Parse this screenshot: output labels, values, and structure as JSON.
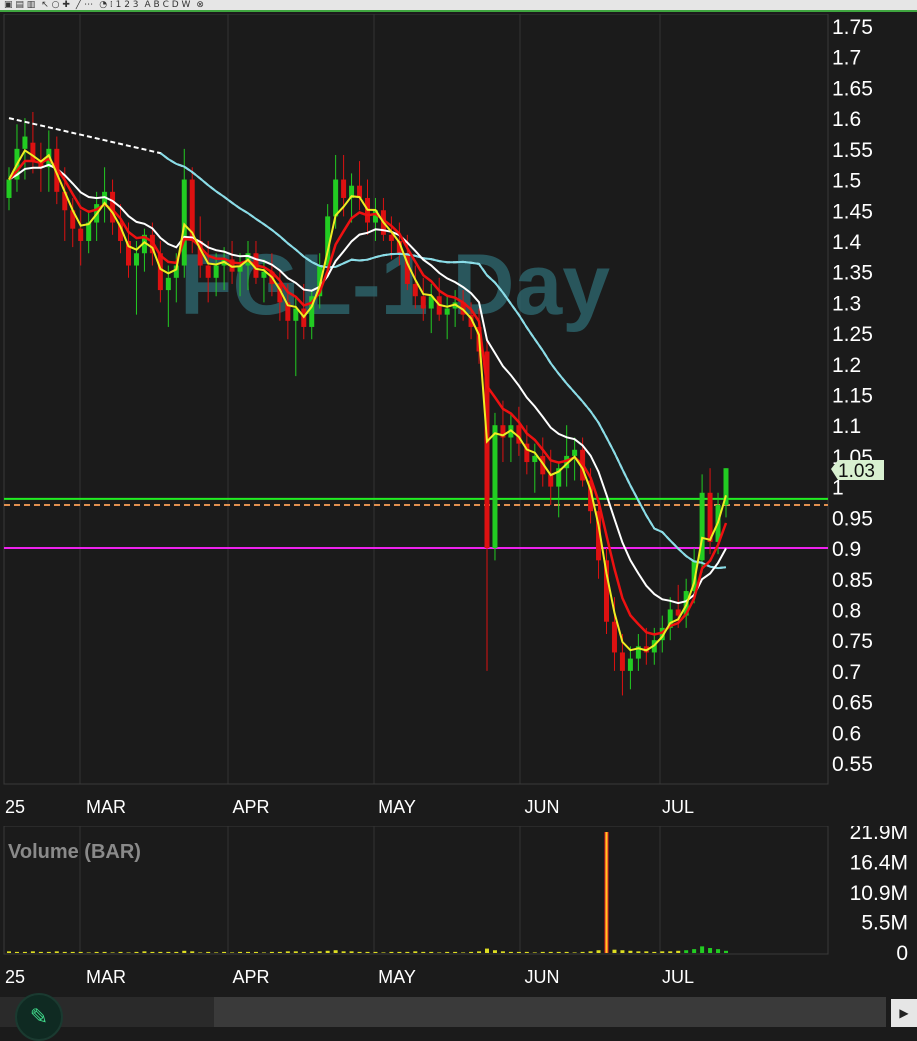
{
  "chart_data": [
    {
      "type": "candlestick",
      "title": "FGL-1 Day",
      "price_axis": {
        "ticks": [
          "1.75",
          "1.7",
          "1.65",
          "1.6",
          "1.55",
          "1.5",
          "1.45",
          "1.4",
          "1.35",
          "1.3",
          "1.25",
          "1.2",
          "1.15",
          "1.1",
          "1.05",
          "1",
          "0.95",
          "0.9",
          "0.85",
          "0.8",
          "0.75",
          "0.7",
          "0.65",
          "0.6",
          "0.55"
        ],
        "ylim": [
          0.52,
          1.77
        ]
      },
      "x_labels": [
        "25",
        "MAR",
        "APR",
        "MAY",
        "JUN",
        "JUL"
      ],
      "last_price": "1.03",
      "horizontal_lines": [
        {
          "value": 0.98,
          "color": "#22ee22"
        },
        {
          "value": 0.97,
          "color": "#e09050"
        },
        {
          "value": 0.9,
          "color": "#ee22ee"
        }
      ],
      "ohlc": [
        [
          1.47,
          1.52,
          1.45,
          1.5
        ],
        [
          1.5,
          1.59,
          1.48,
          1.55
        ],
        [
          1.55,
          1.6,
          1.5,
          1.57
        ],
        [
          1.56,
          1.61,
          1.51,
          1.53
        ],
        [
          1.53,
          1.56,
          1.48,
          1.52
        ],
        [
          1.52,
          1.58,
          1.48,
          1.55
        ],
        [
          1.55,
          1.57,
          1.46,
          1.48
        ],
        [
          1.48,
          1.52,
          1.4,
          1.45
        ],
        [
          1.45,
          1.47,
          1.39,
          1.42
        ],
        [
          1.42,
          1.45,
          1.36,
          1.4
        ],
        [
          1.4,
          1.45,
          1.38,
          1.43
        ],
        [
          1.43,
          1.48,
          1.4,
          1.46
        ],
        [
          1.46,
          1.52,
          1.43,
          1.48
        ],
        [
          1.48,
          1.5,
          1.41,
          1.43
        ],
        [
          1.43,
          1.46,
          1.38,
          1.4
        ],
        [
          1.4,
          1.43,
          1.34,
          1.36
        ],
        [
          1.36,
          1.4,
          1.28,
          1.38
        ],
        [
          1.38,
          1.42,
          1.35,
          1.41
        ],
        [
          1.41,
          1.43,
          1.36,
          1.38
        ],
        [
          1.38,
          1.4,
          1.3,
          1.32
        ],
        [
          1.32,
          1.36,
          1.26,
          1.34
        ],
        [
          1.34,
          1.38,
          1.3,
          1.36
        ],
        [
          1.36,
          1.55,
          1.34,
          1.5
        ],
        [
          1.5,
          1.52,
          1.38,
          1.4
        ],
        [
          1.4,
          1.44,
          1.34,
          1.36
        ],
        [
          1.36,
          1.4,
          1.3,
          1.34
        ],
        [
          1.34,
          1.38,
          1.31,
          1.36
        ],
        [
          1.36,
          1.39,
          1.32,
          1.37
        ],
        [
          1.37,
          1.4,
          1.33,
          1.35
        ],
        [
          1.35,
          1.38,
          1.31,
          1.36
        ],
        [
          1.36,
          1.4,
          1.32,
          1.38
        ],
        [
          1.38,
          1.4,
          1.33,
          1.34
        ],
        [
          1.34,
          1.37,
          1.3,
          1.35
        ],
        [
          1.35,
          1.38,
          1.31,
          1.33
        ],
        [
          1.33,
          1.35,
          1.27,
          1.3
        ],
        [
          1.3,
          1.33,
          1.24,
          1.27
        ],
        [
          1.27,
          1.31,
          1.18,
          1.29
        ],
        [
          1.29,
          1.33,
          1.24,
          1.26
        ],
        [
          1.26,
          1.32,
          1.24,
          1.31
        ],
        [
          1.31,
          1.38,
          1.29,
          1.36
        ],
        [
          1.36,
          1.46,
          1.34,
          1.44
        ],
        [
          1.44,
          1.54,
          1.42,
          1.5
        ],
        [
          1.5,
          1.54,
          1.44,
          1.47
        ],
        [
          1.47,
          1.51,
          1.43,
          1.49
        ],
        [
          1.49,
          1.53,
          1.45,
          1.47
        ],
        [
          1.47,
          1.5,
          1.41,
          1.43
        ],
        [
          1.43,
          1.47,
          1.4,
          1.45
        ],
        [
          1.45,
          1.47,
          1.4,
          1.41
        ],
        [
          1.41,
          1.44,
          1.37,
          1.4
        ],
        [
          1.4,
          1.43,
          1.36,
          1.38
        ],
        [
          1.38,
          1.41,
          1.32,
          1.33
        ],
        [
          1.33,
          1.36,
          1.29,
          1.31
        ],
        [
          1.31,
          1.34,
          1.27,
          1.29
        ],
        [
          1.29,
          1.33,
          1.25,
          1.31
        ],
        [
          1.31,
          1.34,
          1.27,
          1.28
        ],
        [
          1.28,
          1.31,
          1.24,
          1.29
        ],
        [
          1.29,
          1.32,
          1.26,
          1.3
        ],
        [
          1.3,
          1.32,
          1.27,
          1.28
        ],
        [
          1.28,
          1.3,
          1.24,
          1.26
        ],
        [
          1.26,
          1.29,
          1.2,
          1.22
        ],
        [
          1.22,
          1.24,
          0.7,
          0.9
        ],
        [
          0.9,
          1.12,
          0.88,
          1.1
        ],
        [
          1.1,
          1.14,
          1.04,
          1.08
        ],
        [
          1.08,
          1.12,
          1.04,
          1.1
        ],
        [
          1.1,
          1.13,
          1.05,
          1.07
        ],
        [
          1.07,
          1.1,
          1.02,
          1.04
        ],
        [
          1.04,
          1.07,
          0.99,
          1.05
        ],
        [
          1.05,
          1.08,
          1.0,
          1.02
        ],
        [
          1.02,
          1.06,
          0.97,
          1.0
        ],
        [
          1.0,
          1.04,
          0.95,
          1.03
        ],
        [
          1.03,
          1.1,
          1.0,
          1.05
        ],
        [
          1.05,
          1.08,
          1.01,
          1.06
        ],
        [
          1.06,
          1.08,
          1.0,
          1.01
        ],
        [
          1.01,
          1.03,
          0.94,
          0.96
        ],
        [
          0.96,
          0.98,
          0.85,
          0.88
        ],
        [
          0.88,
          0.9,
          0.76,
          0.78
        ],
        [
          0.78,
          0.82,
          0.7,
          0.73
        ],
        [
          0.73,
          0.76,
          0.66,
          0.7
        ],
        [
          0.7,
          0.74,
          0.67,
          0.72
        ],
        [
          0.72,
          0.76,
          0.7,
          0.74
        ],
        [
          0.74,
          0.77,
          0.71,
          0.73
        ],
        [
          0.73,
          0.77,
          0.71,
          0.75
        ],
        [
          0.75,
          0.79,
          0.73,
          0.77
        ],
        [
          0.77,
          0.82,
          0.75,
          0.8
        ],
        [
          0.8,
          0.84,
          0.77,
          0.79
        ],
        [
          0.79,
          0.85,
          0.77,
          0.83
        ],
        [
          0.83,
          0.9,
          0.81,
          0.88
        ],
        [
          0.88,
          1.02,
          0.86,
          0.99
        ],
        [
          0.99,
          1.03,
          0.89,
          0.91
        ],
        [
          0.91,
          0.99,
          0.89,
          0.97
        ],
        [
          0.97,
          1.03,
          0.95,
          1.03
        ]
      ]
    },
    {
      "type": "bar",
      "title": "Volume (BAR)",
      "y_ticks": [
        "21.9M",
        "16.4M",
        "10.9M",
        "5.5M",
        "0"
      ],
      "x_labels": [
        "25",
        "MAR",
        "APR",
        "MAY",
        "JUN",
        "JUL"
      ],
      "ylim": [
        0,
        21.9
      ],
      "unit": "M"
    }
  ],
  "toolbar": {
    "icons": [
      "drawing-tools-icon",
      "cursor-icon",
      "line-icon",
      "fib-icon",
      "text-icon",
      "zoom-icon",
      "settings-icon"
    ]
  }
}
